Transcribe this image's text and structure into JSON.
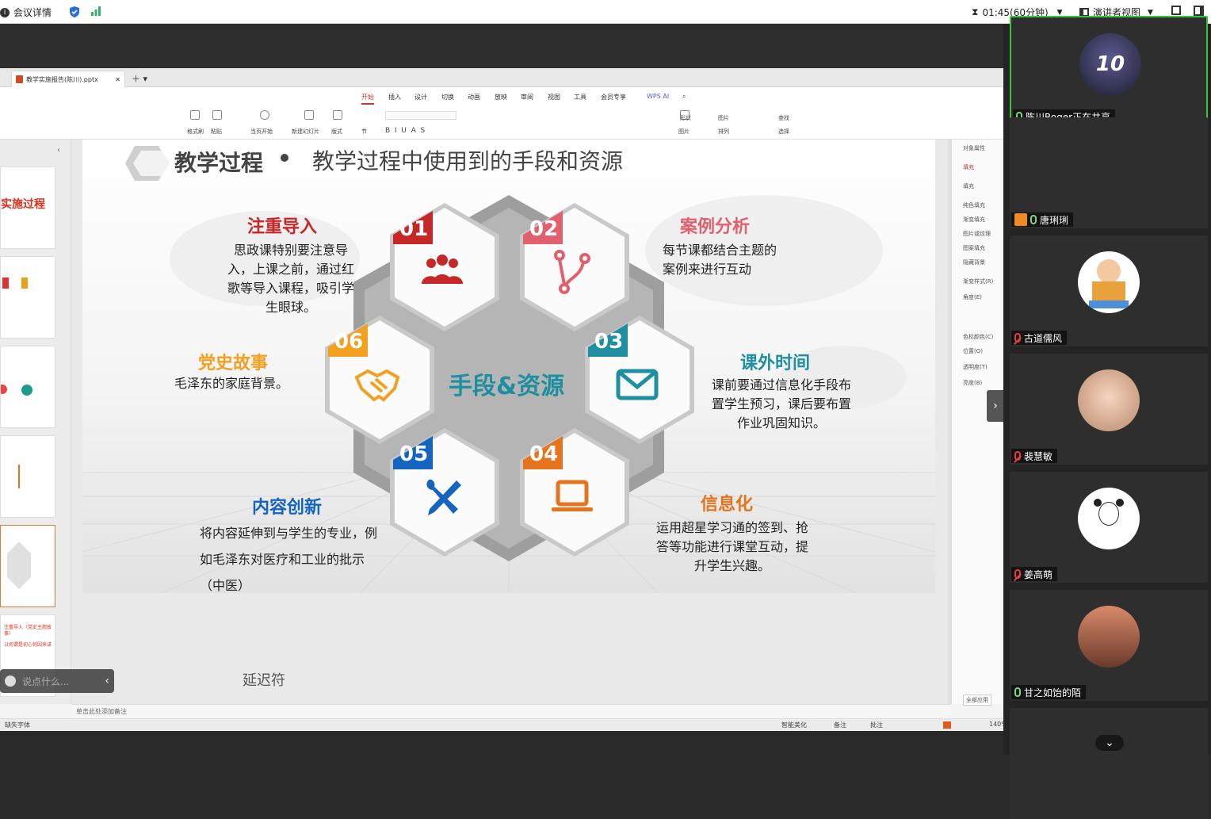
{
  "topbar": {
    "meeting_info": "会议详情",
    "timer": "01:45(60分钟)",
    "view_mode": "演讲者视图"
  },
  "wps": {
    "doc_tab": "教学实施报告(陈川).pptx",
    "menu": [
      "开始",
      "插入",
      "设计",
      "切换",
      "动画",
      "放映",
      "审阅",
      "视图",
      "工具",
      "会员专享"
    ],
    "menu_active": "开始",
    "wps_ai": "WPS AI",
    "ribbon_labels": [
      "格式刷",
      "粘贴",
      "当页开始",
      "新建幻灯片",
      "版式",
      "节",
      "形状",
      "文本框",
      "图片",
      "排列",
      "查找",
      "选择"
    ],
    "notes_placeholder": "单击此处添加备注",
    "status_left": "缺失字体",
    "status_items": [
      "智能美化",
      "备注",
      "批注"
    ],
    "zoom": "140%",
    "apply_all": "全部应用",
    "props": {
      "title": "对象属性",
      "tab": "填充",
      "section": "填充",
      "options": [
        "纯色填充",
        "渐变填充",
        "图片或纹理",
        "图案填充",
        "隐藏背景"
      ],
      "fields": [
        "渐变样式(R)",
        "角度(E)",
        "色标颜色(C)",
        "位置(O)",
        "透明度(T)",
        "亮度(B)"
      ]
    }
  },
  "thumbs": {
    "t1_title": "实施过程",
    "t6_text1": "注重导入（党史主题故事）",
    "t6_text2": "以何谓是初心何因来讲"
  },
  "slide": {
    "title": "教学过程",
    "subtitle": "教学过程中使用到的手段和资源",
    "center": "手段&资源",
    "items": [
      {
        "num": "01",
        "title": "注重导入",
        "body": "思政课特别要注意导入，上课之前，通过红歌等导入课程，吸引学生眼球。",
        "icon": "group-icon",
        "color": "#c62828"
      },
      {
        "num": "02",
        "title": "案例分析",
        "body": "每节课都结合主题的案例来进行互动",
        "icon": "branch-icon",
        "color": "#e0606e"
      },
      {
        "num": "03",
        "title": "课外时间",
        "body": "课前要通过信息化手段布置学生预习，课后要布置作业巩固知识。",
        "icon": "mail-icon",
        "color": "#1e8fa0"
      },
      {
        "num": "04",
        "title": "信息化",
        "body": "运用超星学习通的签到、抢答等功能进行课堂互动，提升学生兴趣。",
        "icon": "laptop-icon",
        "color": "#e6731e"
      },
      {
        "num": "05",
        "title": "内容创新",
        "body": "将内容延伸到与学生的专业，例如毛泽东对医疗和工业的批示（中医）",
        "icon": "tools-icon",
        "color": "#1565c0"
      },
      {
        "num": "06",
        "title": "党史故事",
        "body": "毛泽东的家庭背景。",
        "icon": "handshake-icon",
        "color": "#f2a020"
      }
    ]
  },
  "chat_placeholder": "说点什么...",
  "caption": "延迟符",
  "participants": [
    {
      "name": "陈川Roger正在共享",
      "avatar": "jersey",
      "mic": "on"
    },
    {
      "name": "唐琍琍",
      "avatar": "none",
      "mic": "on"
    },
    {
      "name": "古道儒风",
      "avatar": "cartoon",
      "mic": "off"
    },
    {
      "name": "裴慧敏",
      "avatar": "girl",
      "mic": "off"
    },
    {
      "name": "姜高萌",
      "avatar": "sketch",
      "mic": "off"
    },
    {
      "name": "甘之如饴的陌",
      "avatar": "photo",
      "mic": "on"
    }
  ],
  "colors": {
    "accent_green": "#35c735",
    "red": "#c62828",
    "teal": "#1e8fa0",
    "orange": "#e6731e",
    "blue": "#1565c0",
    "gold": "#f2a020"
  }
}
